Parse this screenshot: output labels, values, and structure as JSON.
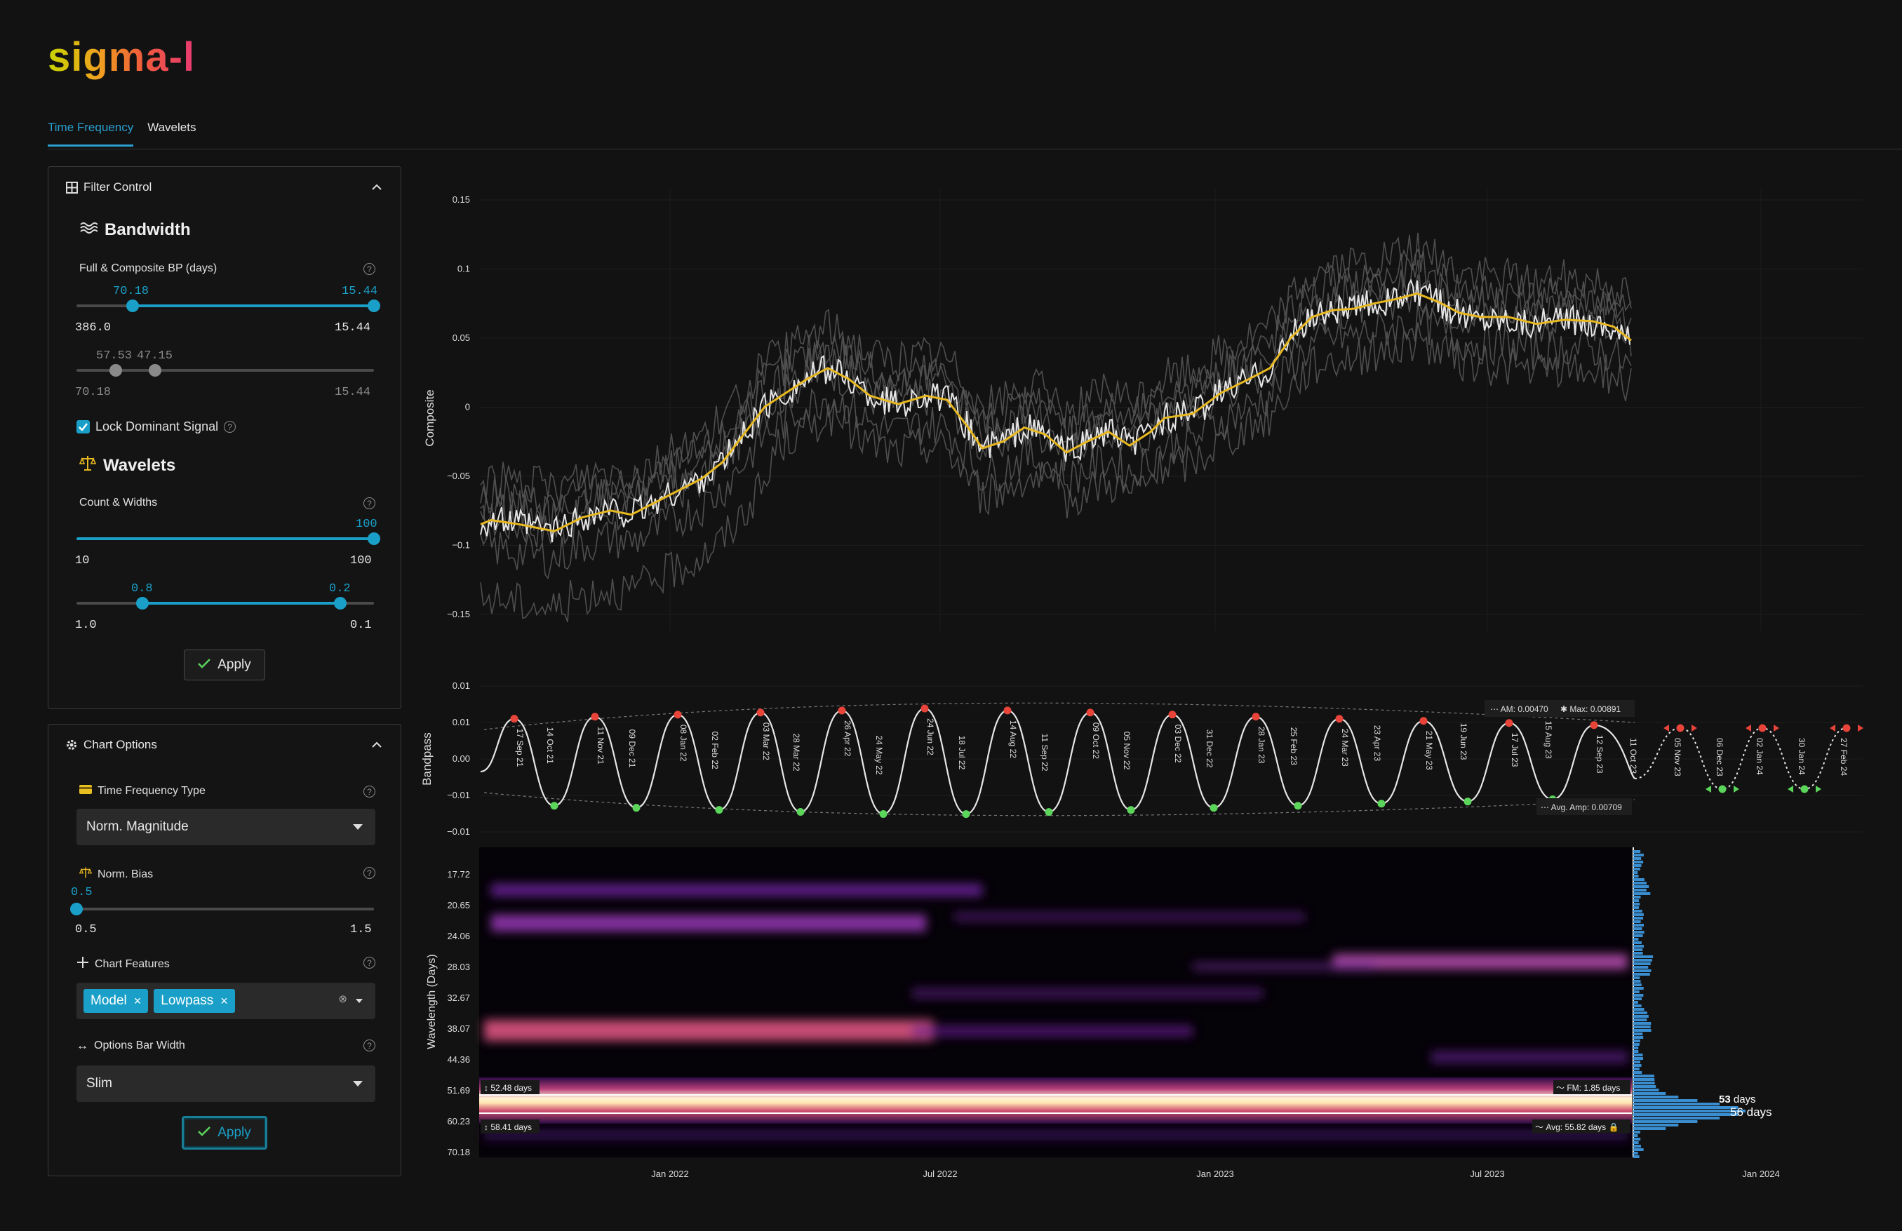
{
  "app": {
    "logo": "sigma-l"
  },
  "tabs": [
    {
      "label": "Time Frequency",
      "active": true
    },
    {
      "label": "Wavelets",
      "active": false
    }
  ],
  "filter_control": {
    "title": "Filter Control",
    "bandwidth": {
      "title": "Bandwidth",
      "label": "Full & Composite BP (days)",
      "slider1": {
        "low": "70.18",
        "high": "15.44",
        "min": "386.0",
        "max": "15.44"
      },
      "slider2": {
        "low": "57.53",
        "high": "47.15",
        "min": "70.18",
        "max": "15.44"
      }
    },
    "lock_label": "Lock Dominant Signal",
    "lock_checked": true,
    "wavelets": {
      "title": "Wavelets",
      "label": "Count & Widths",
      "slider1": {
        "value": "100",
        "min": "10",
        "max": "100"
      },
      "slider2": {
        "low": "0.8",
        "high": "0.2",
        "min": "1.0",
        "max": "0.1"
      }
    },
    "apply_label": "Apply"
  },
  "chart_options": {
    "title": "Chart Options",
    "tf_type_label": "Time Frequency Type",
    "tf_type_value": "Norm. Magnitude",
    "norm_bias_label": "Norm. Bias",
    "norm_bias": {
      "value": "0.5",
      "min": "0.5",
      "max": "1.5"
    },
    "features_label": "Chart Features",
    "features": [
      "Model",
      "Lowpass"
    ],
    "bar_width_label": "Options Bar Width",
    "bar_width_value": "Slim",
    "apply_label": "Apply"
  },
  "charts": {
    "composite": {
      "ylabel": "Composite",
      "yticks": [
        "0.15",
        "0.1",
        "0.05",
        "0",
        "−0.05",
        "−0.1",
        "−0.15"
      ]
    },
    "bandpass": {
      "ylabel": "Bandpass",
      "yticks": [
        "0.01",
        "0.01",
        "0.00",
        "−0.01",
        "−0.01"
      ],
      "peak_labels": [
        "17 Sep 21",
        "11 Nov 21",
        "08 Jan 22",
        "03 Mar 22",
        "26 Apr 22",
        "24 Jun 22",
        "14 Aug 22",
        "09 Oct 22",
        "03 Dec 22",
        "28 Jan 23",
        "24 Mar 23",
        "21 May 23",
        "17 Jul 23",
        "12 Sep 23",
        "05 Nov 23",
        "02 Jan 24",
        "27 Feb 24"
      ],
      "trough_labels": [
        "14 Oct 21",
        "09 Dec 21",
        "02 Feb 22",
        "28 Mar 22",
        "24 May 22",
        "18 Jul 22",
        "11 Sep 22",
        "05 Nov 22",
        "31 Dec 22",
        "25 Feb 23",
        "23 Apr 23",
        "19 Jun 23",
        "15 Aug 23",
        "11 Oct 23",
        "06 Dec 23",
        "30 Jan 24"
      ],
      "am_label": "AM: 0.00470",
      "max_label": "Max: 0.00891",
      "avg_amp_label": "Avg. Amp: 0.00709"
    },
    "spectrogram": {
      "ylabel": "Wavelength (Days)",
      "yticks": [
        "17.72",
        "20.65",
        "24.06",
        "28.03",
        "32.67",
        "38.07",
        "44.36",
        "51.69",
        "60.23",
        "70.18"
      ],
      "xticks": [
        "Jan 2022",
        "Jul 2022",
        "Jan 2023",
        "Jul 2023",
        "Jan 2024"
      ],
      "band_top_label": "52.48 days",
      "band_bottom_label": "58.41 days",
      "fm_label": "FM: 1.85 days",
      "avg_label": "Avg: 55.82 days",
      "hist_label_1_value": "53",
      "hist_label_1_unit": "days",
      "hist_label_2": "56 days"
    }
  },
  "colors": {
    "accent": "#1aa0c8",
    "lowpass": "#e8b820",
    "peak": "#e8443a",
    "trough": "#5bd65b"
  }
}
